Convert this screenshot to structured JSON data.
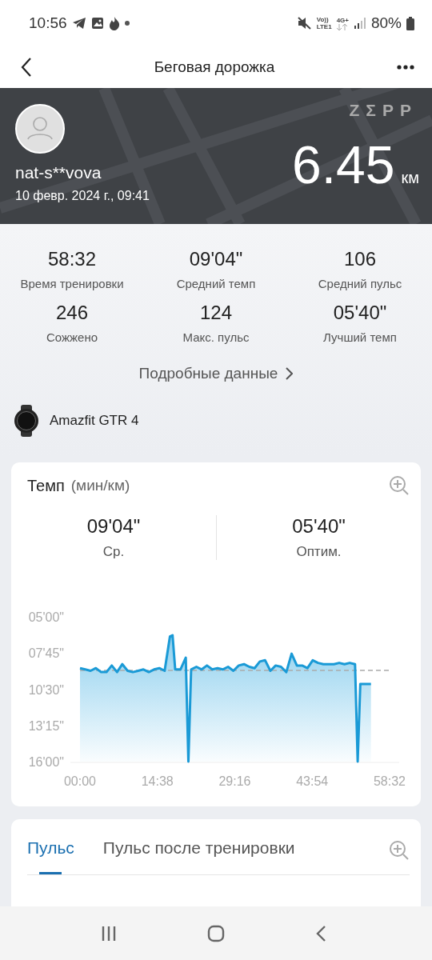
{
  "status_bar": {
    "time": "10:56",
    "volte_top": "Vo))",
    "volte_bottom": "LTE1",
    "network": "4G+",
    "battery": "80%"
  },
  "app_bar": {
    "title": "Беговая дорожка"
  },
  "summary": {
    "brand": "ZΣPP",
    "username": "nat-s**vova",
    "date": "10 февр. 2024 г., 09:41",
    "distance": "6.45",
    "unit": "км"
  },
  "stats": [
    {
      "value": "58:32",
      "label": "Время тренировки"
    },
    {
      "value": "09'04\"",
      "label": "Средний темп"
    },
    {
      "value": "106",
      "label": "Средний пульс"
    },
    {
      "value": "246",
      "label": "Сожжено"
    },
    {
      "value": "124",
      "label": "Макс. пульс"
    },
    {
      "value": "05'40\"",
      "label": "Лучший темп"
    }
  ],
  "details_link": {
    "label": "Подробные данные"
  },
  "device": {
    "name": "Amazfit GTR 4"
  },
  "pace_card": {
    "title": "Темп",
    "unit": "(мин/км)",
    "summary": [
      {
        "value": "09'04\"",
        "label": "Ср."
      },
      {
        "value": "05'40\"",
        "label": "Оптим."
      }
    ],
    "chart": {
      "y_labels": [
        "05'00\"",
        "07'45\"",
        "10'30\"",
        "13'15\"",
        "16'00\""
      ],
      "x_labels": [
        "00:00",
        "14:38",
        "29:16",
        "43:54",
        "58:32"
      ]
    }
  },
  "pulse_card": {
    "tabs": [
      {
        "label": "Пульс",
        "selected": true
      },
      {
        "label": "Пульс после тренировки",
        "selected": false
      }
    ]
  }
}
